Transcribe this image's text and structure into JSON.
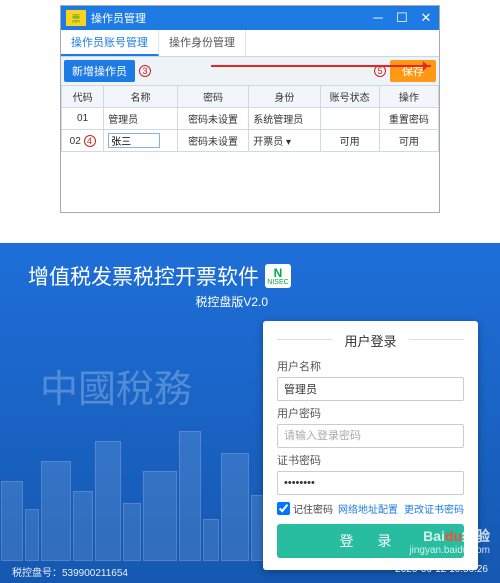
{
  "win1": {
    "title": "操作员管理",
    "tabs": [
      "操作员账号管理",
      "操作身份管理"
    ],
    "toolbar": {
      "add": "新增操作员",
      "save": "保存"
    },
    "headers": [
      "代码",
      "名称",
      "密码",
      "身份",
      "账号状态",
      "操作"
    ],
    "rows": [
      {
        "code": "01",
        "name": "管理员",
        "pwd": "密码未设置",
        "role": "系统管理员",
        "status": " ",
        "op": "重置密码"
      },
      {
        "code": "02",
        "name": "张三",
        "pwd": "密码未设置",
        "role": "开票员 ▾",
        "status": "可用",
        "op": "可用"
      }
    ],
    "annot": {
      "n3": "3",
      "n4": "4",
      "n5": "5"
    }
  },
  "win2": {
    "title": "增值税发票税控开票软件",
    "subtitle": "税控盘版V2.0",
    "bg": "中國稅務",
    "login": {
      "heading": "用户登录",
      "user_label": "用户名称",
      "user_value": "管理员",
      "pass_label": "用户密码",
      "pass_placeholder": "请输入登录密码",
      "cert_label": "证书密码",
      "cert_value": "••••••••",
      "remember": "记住密码",
      "link1": "网络地址配置",
      "link2": "更改证书密码",
      "button": "登 录"
    },
    "footer": {
      "disk": "税控盘号：539900211654",
      "time": "2020-06-12 10:56:26"
    },
    "watermark": {
      "brand_pre": "Bai",
      "brand_mid": "du",
      "brand_post": "经验",
      "url": "jingyan.baidu.com"
    }
  }
}
